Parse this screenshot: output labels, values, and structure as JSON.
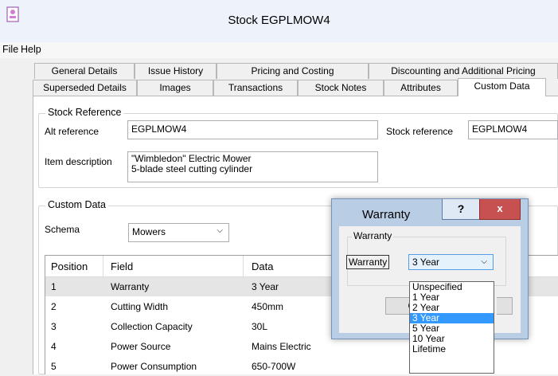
{
  "window": {
    "title": "Stock EGPLMOW4"
  },
  "menu": {
    "file": "File",
    "help": "Help"
  },
  "tabs_row1": [
    "General Details",
    "Issue History",
    "Pricing and Costing",
    "Discounting and Additional Pricing"
  ],
  "tabs_row2": [
    "Superseded Details",
    "Images",
    "Transactions",
    "Stock Notes",
    "Attributes",
    "Custom Data"
  ],
  "active_tab": "Custom Data",
  "stock_reference": {
    "legend": "Stock Reference",
    "alt_reference_label": "Alt reference",
    "alt_reference_value": "EGPLMOW4",
    "stock_reference_label": "Stock reference",
    "stock_reference_value": "EGPLMOW4",
    "item_description_label": "Item description",
    "item_description_line1": "\"Wimbledon\" Electric Mower",
    "item_description_line2": "5-blade steel cutting cylinder"
  },
  "custom_data": {
    "legend": "Custom Data",
    "schema_label": "Schema",
    "schema_value": "Mowers",
    "columns": [
      "Position",
      "Field",
      "Data"
    ],
    "rows": [
      {
        "position": "1",
        "field": "Warranty",
        "data": "3 Year"
      },
      {
        "position": "2",
        "field": "Cutting Width",
        "data": "450mm"
      },
      {
        "position": "3",
        "field": "Collection Capacity",
        "data": "30L"
      },
      {
        "position": "4",
        "field": "Power Source",
        "data": "Mains Electric"
      },
      {
        "position": "5",
        "field": "Power Consumption",
        "data": "650-700W"
      }
    ],
    "selected_row": 0
  },
  "dialog": {
    "title": "Warranty",
    "help_label": "?",
    "close_label": "x",
    "group_legend": "Warranty",
    "field_label": "Warranty",
    "selected_value": "3 Year",
    "ok_label": "OK",
    "options": [
      "Unspecified",
      "1 Year",
      "2 Year",
      "3 Year",
      "5 Year",
      "10 Year",
      "Lifetime"
    ],
    "selected_option_index": 3
  },
  "colors": {
    "selection_blue": "#3399ff",
    "dialog_frame": "#b9cde5",
    "close_red": "#c75050"
  },
  "icons": {
    "app": "user-card-icon",
    "dropdown": "chevron-down-icon"
  }
}
